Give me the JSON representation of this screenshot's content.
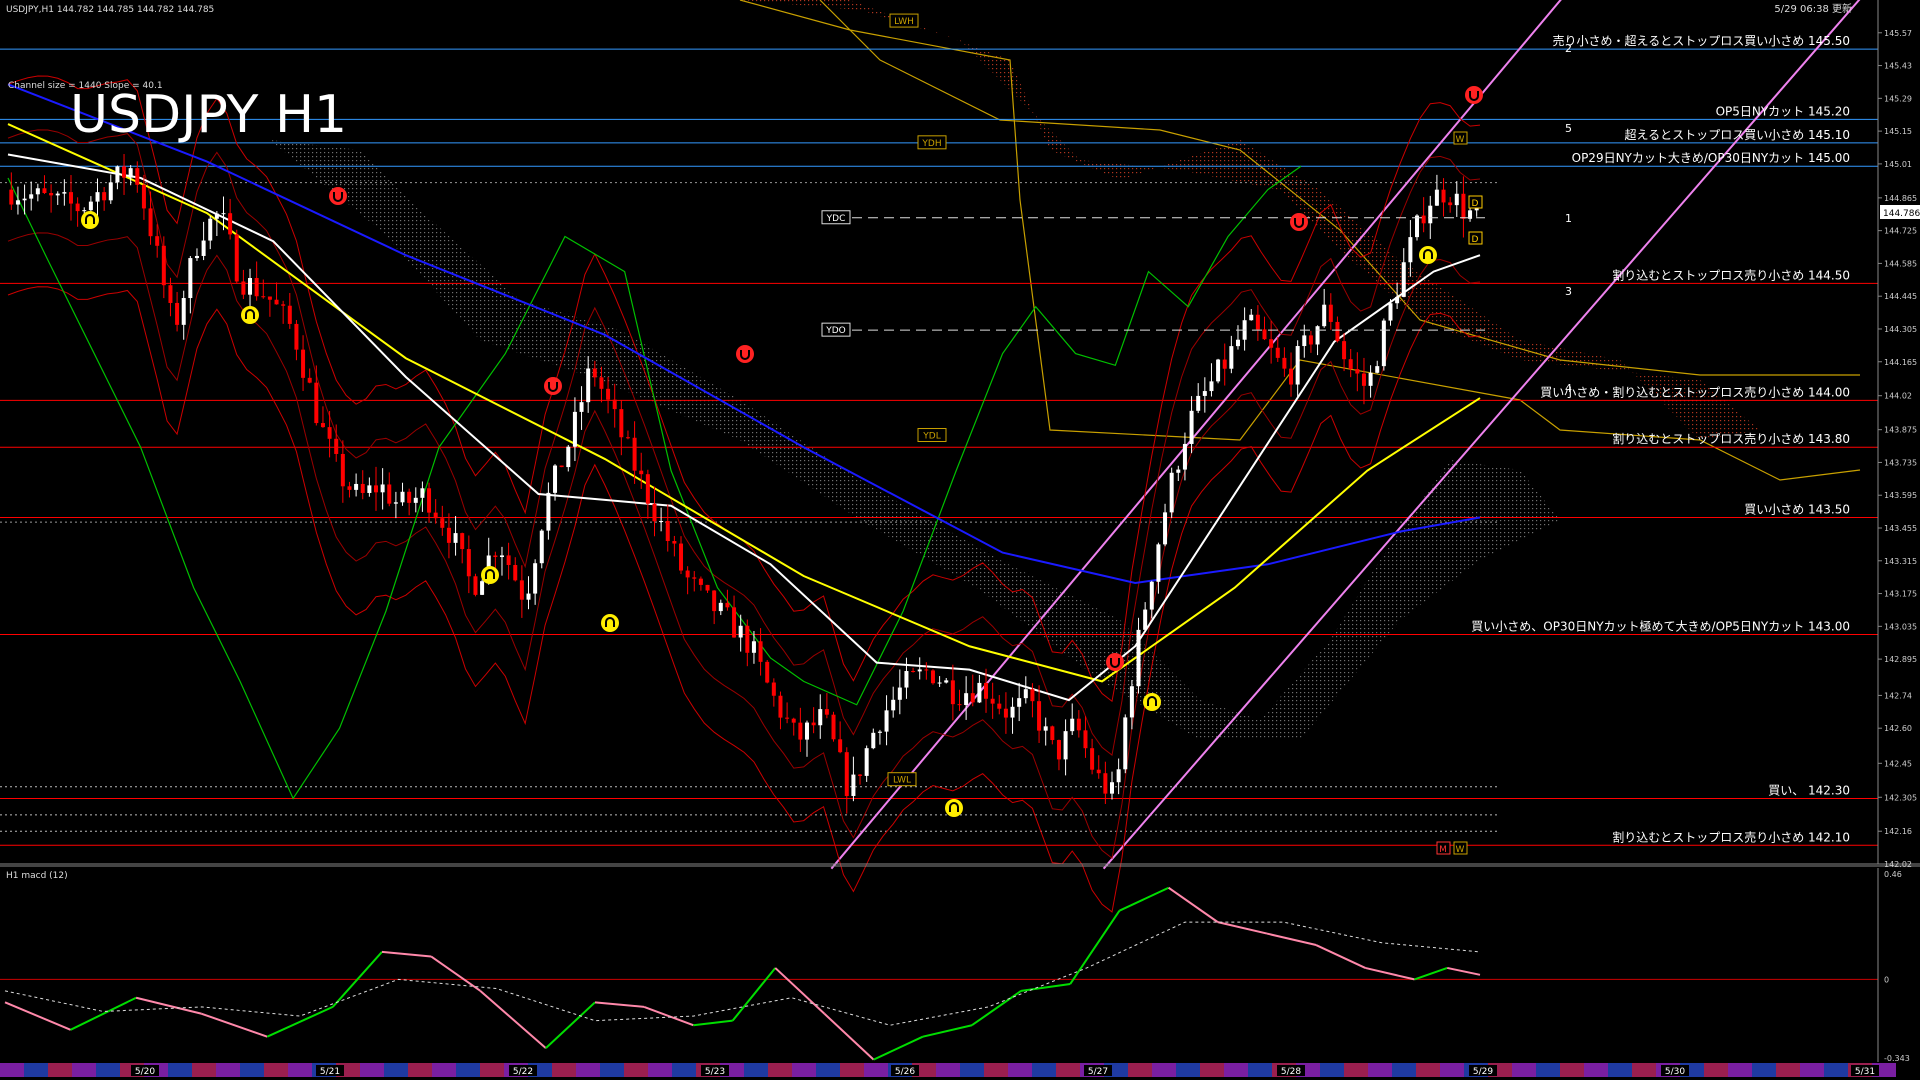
{
  "header": {
    "symbol_info": "USDJPY,H1  144.782 144.785 144.782 144.785",
    "channel_info": "Channel size = 1440 Slope = 40.1",
    "big_title": "USDJPY H1",
    "timestamp": "5/29 06:38 更新"
  },
  "subwindow": {
    "label": "H1  macd (12)"
  },
  "colors": {
    "background": "#000000",
    "bull_candle": "#ffffff",
    "bear_candle": "#ff0000",
    "ma_white": "#ffffff",
    "ma_yellow": "#ffff00",
    "ma_blue": "#1a1aff",
    "chikou_green": "#00c000",
    "channel_pink": "#ee82ee",
    "resistance_line": "#ff0000",
    "cut_line": "#3399ff",
    "macd_green": "#00dd00",
    "macd_pink": "#ff88aa"
  },
  "chart_data": {
    "type": "candlestick",
    "symbol": "USDJPY",
    "timeframe": "H1",
    "ylim": [
      142.02,
      145.71
    ],
    "y_ticks": [
      145.57,
      145.43,
      145.29,
      145.15,
      145.01,
      144.865,
      144.725,
      144.585,
      144.445,
      144.305,
      144.165,
      144.02,
      143.875,
      143.735,
      143.595,
      143.455,
      143.315,
      143.175,
      143.035,
      142.895,
      142.74,
      142.6,
      142.45,
      142.305,
      142.16,
      142.02
    ],
    "current_price": 144.786,
    "x_labels": [
      "5/20",
      "5/21",
      "5/22",
      "5/23",
      "5/26",
      "5/27",
      "5/28",
      "5/29",
      "5/30",
      "5/31"
    ],
    "close_path": [
      [
        0,
        144.9
      ],
      [
        14,
        144.85
      ],
      [
        22,
        144.82
      ],
      [
        30,
        144.92
      ],
      [
        38,
        145.0
      ],
      [
        44,
        144.68
      ],
      [
        50,
        144.3
      ],
      [
        58,
        144.72
      ],
      [
        64,
        144.8
      ],
      [
        70,
        144.52
      ],
      [
        78,
        144.45
      ],
      [
        86,
        144.3
      ],
      [
        94,
        143.9
      ],
      [
        100,
        143.68
      ],
      [
        106,
        143.58
      ],
      [
        112,
        143.64
      ],
      [
        118,
        143.55
      ],
      [
        126,
        143.6
      ],
      [
        134,
        143.42
      ],
      [
        140,
        143.2
      ],
      [
        148,
        143.4
      ],
      [
        156,
        143.15
      ],
      [
        162,
        143.55
      ],
      [
        170,
        143.85
      ],
      [
        176,
        144.15
      ],
      [
        182,
        143.95
      ],
      [
        188,
        143.75
      ],
      [
        196,
        143.5
      ],
      [
        204,
        143.25
      ],
      [
        210,
        143.15
      ],
      [
        218,
        143.05
      ],
      [
        224,
        142.95
      ],
      [
        230,
        142.75
      ],
      [
        238,
        142.55
      ],
      [
        246,
        142.65
      ],
      [
        254,
        142.32
      ],
      [
        262,
        142.62
      ],
      [
        270,
        142.78
      ],
      [
        278,
        142.85
      ],
      [
        286,
        142.75
      ],
      [
        294,
        142.78
      ],
      [
        302,
        142.66
      ],
      [
        308,
        142.72
      ],
      [
        316,
        142.48
      ],
      [
        322,
        142.62
      ],
      [
        328,
        142.4
      ],
      [
        334,
        142.3
      ],
      [
        338,
        142.75
      ],
      [
        344,
        143.2
      ],
      [
        350,
        143.6
      ],
      [
        356,
        143.9
      ],
      [
        362,
        144.05
      ],
      [
        368,
        144.18
      ],
      [
        374,
        144.33
      ],
      [
        380,
        144.22
      ],
      [
        386,
        144.1
      ],
      [
        392,
        144.25
      ],
      [
        398,
        144.4
      ],
      [
        404,
        144.15
      ],
      [
        410,
        144.05
      ],
      [
        416,
        144.35
      ],
      [
        422,
        144.62
      ],
      [
        428,
        144.85
      ],
      [
        434,
        144.9
      ],
      [
        440,
        144.8
      ],
      [
        444,
        144.79
      ]
    ],
    "indicators": {
      "ma_white": [
        [
          0,
          145.05
        ],
        [
          40,
          144.95
        ],
        [
          80,
          144.68
        ],
        [
          120,
          144.1
        ],
        [
          160,
          143.6
        ],
        [
          200,
          143.55
        ],
        [
          230,
          143.3
        ],
        [
          262,
          142.88
        ],
        [
          290,
          142.85
        ],
        [
          320,
          142.72
        ],
        [
          340,
          142.95
        ],
        [
          370,
          143.6
        ],
        [
          400,
          144.25
        ],
        [
          430,
          144.55
        ],
        [
          444,
          144.62
        ]
      ],
      "ma_yellow": [
        [
          0,
          145.18
        ],
        [
          60,
          144.8
        ],
        [
          120,
          144.18
        ],
        [
          180,
          143.75
        ],
        [
          240,
          143.25
        ],
        [
          290,
          142.95
        ],
        [
          330,
          142.8
        ],
        [
          370,
          143.2
        ],
        [
          410,
          143.7
        ],
        [
          444,
          144.01
        ]
      ],
      "ma_blue": [
        [
          0,
          145.35
        ],
        [
          60,
          145.02
        ],
        [
          120,
          144.62
        ],
        [
          180,
          144.28
        ],
        [
          240,
          143.8
        ],
        [
          300,
          143.35
        ],
        [
          340,
          143.22
        ],
        [
          380,
          143.3
        ],
        [
          420,
          143.44
        ],
        [
          444,
          143.5
        ]
      ],
      "chikou_green": [
        [
          0,
          144.95
        ],
        [
          12,
          144.6
        ],
        [
          26,
          144.2
        ],
        [
          40,
          143.8
        ],
        [
          56,
          143.2
        ],
        [
          70,
          142.8
        ],
        [
          86,
          142.3
        ],
        [
          100,
          142.6
        ],
        [
          114,
          143.1
        ],
        [
          130,
          143.8
        ],
        [
          150,
          144.2
        ],
        [
          168,
          144.7
        ],
        [
          186,
          144.55
        ],
        [
          200,
          143.7
        ],
        [
          214,
          143.2
        ],
        [
          230,
          142.9
        ],
        [
          240,
          142.8
        ],
        [
          256,
          142.7
        ],
        [
          270,
          143.1
        ],
        [
          286,
          143.7
        ],
        [
          300,
          144.2
        ],
        [
          310,
          144.4
        ],
        [
          322,
          144.2
        ],
        [
          334,
          144.15
        ],
        [
          344,
          144.55
        ],
        [
          356,
          144.4
        ],
        [
          368,
          144.7
        ],
        [
          380,
          144.9
        ],
        [
          390,
          145.0
        ]
      ]
    },
    "channel_lines": [
      {
        "name": "1",
        "color": "#ee82ee",
        "from": [
          248,
          142.0
        ],
        "to": [
          470,
          145.75
        ]
      },
      {
        "name": "2",
        "color": "#ee82ee",
        "from": [
          330,
          142.0
        ],
        "to": [
          560,
          145.75
        ]
      }
    ],
    "horizontal_levels": [
      {
        "label": "売り小さめ・超えるとストップロス買い小さめ 145.50",
        "value": 145.5,
        "color": "#3399ff"
      },
      {
        "label": "OP5日NYカット 145.20",
        "value": 145.2,
        "color": "#3399ff"
      },
      {
        "label": "超えるとストップロス買い小さめ 145.10",
        "value": 145.1,
        "color": "#3399ff"
      },
      {
        "label": "OP29日NYカット大きめ/OP30日NYカット 145.00",
        "value": 145.0,
        "color": "#3399ff"
      },
      {
        "label": "割り込むとストップロス売り小さめ 144.50",
        "value": 144.5,
        "color": "#ff0000"
      },
      {
        "label": "買い小さめ・割り込むとストップロス売り小さめ 144.00",
        "value": 144.0,
        "color": "#ff0000"
      },
      {
        "label": "割り込むとストップロス売り小さめ 143.80",
        "value": 143.8,
        "color": "#ff0000"
      },
      {
        "label": "買い小さめ 143.50",
        "value": 143.5,
        "color": "#ff0000"
      },
      {
        "label": "買い小さめ、OP30日NYカット極めて大きめ/OP5日NYカット 143.00",
        "value": 143.0,
        "color": "#ff0000"
      },
      {
        "label": "買い、 142.30",
        "value": 142.3,
        "color": "#ff0000"
      },
      {
        "label": "割り込むとストップロス売り小さめ 142.10",
        "value": 142.1,
        "color": "#ff0000"
      }
    ],
    "reference_tags": [
      {
        "label": "LWH",
        "value": 145.62
      },
      {
        "label": "YDH",
        "value": 145.1
      },
      {
        "label": "YDC",
        "value": 144.78
      },
      {
        "label": "YDO",
        "value": 144.3
      },
      {
        "label": "YDL",
        "value": 143.85
      },
      {
        "label": "LWL",
        "value": 142.38
      }
    ],
    "macd": {
      "ylim": [
        -0.343,
        0.46
      ],
      "y_ticks": [
        0.46,
        0.0,
        -0.343
      ],
      "main": [
        [
          0,
          -0.1
        ],
        [
          40,
          -0.22
        ],
        [
          80,
          -0.08
        ],
        [
          120,
          -0.15
        ],
        [
          160,
          -0.25
        ],
        [
          200,
          -0.12
        ],
        [
          230,
          0.12
        ],
        [
          260,
          0.1
        ],
        [
          290,
          -0.05
        ],
        [
          330,
          -0.3
        ],
        [
          360,
          -0.1
        ],
        [
          390,
          -0.12
        ],
        [
          420,
          -0.2
        ],
        [
          444,
          -0.18
        ],
        [
          470,
          0.05
        ],
        [
          500,
          -0.15
        ],
        [
          530,
          -0.35
        ],
        [
          560,
          -0.25
        ],
        [
          590,
          -0.2
        ],
        [
          620,
          -0.05
        ],
        [
          650,
          -0.02
        ],
        [
          680,
          0.3
        ],
        [
          710,
          0.4
        ],
        [
          740,
          0.25
        ],
        [
          770,
          0.2
        ],
        [
          800,
          0.15
        ],
        [
          830,
          0.05
        ],
        [
          860,
          0.0
        ],
        [
          880,
          0.05
        ],
        [
          900,
          0.02
        ]
      ],
      "signal": [
        [
          0,
          -0.05
        ],
        [
          60,
          -0.14
        ],
        [
          120,
          -0.12
        ],
        [
          180,
          -0.16
        ],
        [
          240,
          0.0
        ],
        [
          300,
          -0.04
        ],
        [
          360,
          -0.18
        ],
        [
          420,
          -0.16
        ],
        [
          480,
          -0.08
        ],
        [
          540,
          -0.2
        ],
        [
          600,
          -0.12
        ],
        [
          660,
          0.05
        ],
        [
          720,
          0.25
        ],
        [
          780,
          0.25
        ],
        [
          840,
          0.16
        ],
        [
          900,
          0.12
        ]
      ]
    },
    "annotations": [
      "1",
      "2",
      "3",
      "4",
      "5",
      "D",
      "D",
      "W",
      "M",
      "W"
    ]
  }
}
